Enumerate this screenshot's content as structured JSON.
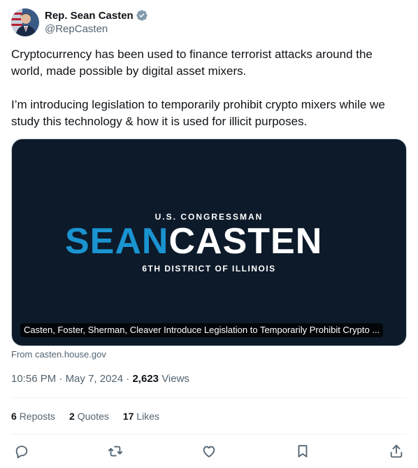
{
  "author": {
    "display_name": "Rep. Sean Casten",
    "handle": "@RepCasten",
    "verified_color": "#829aab"
  },
  "tweet": {
    "paragraphs": [
      "Cryptocurrency has been used to finance terrorist attacks around the world, made possible by digital asset mixers.",
      "I’m introducing legislation to temporarily prohibit crypto mixers while we study this technology & how it is used for illicit purposes."
    ]
  },
  "card": {
    "kicker": "U.S. CONGRESSMAN",
    "logo_part1": "SEAN",
    "logo_part2": "CASTEN",
    "subtitle": "6TH DISTRICT OF ILLINOIS",
    "caption": "Casten, Foster, Sherman, Cleaver Introduce Legislation to Temporarily Prohibit Crypto ...",
    "background_color": "#0d1a2a",
    "accent_color": "#1a93d0"
  },
  "source": "From casten.house.gov",
  "meta": {
    "time": "10:56 PM",
    "separator": "·",
    "date": "May 7, 2024",
    "views_count": "2,623",
    "views_label": "Views"
  },
  "stats": {
    "reposts_count": "6",
    "reposts_label": "Reposts",
    "quotes_count": "2",
    "quotes_label": "Quotes",
    "likes_count": "17",
    "likes_label": "Likes"
  },
  "actions": {
    "icons": [
      "reply-icon",
      "repost-icon",
      "like-icon",
      "bookmark-icon",
      "share-icon"
    ]
  },
  "colors": {
    "text_primary": "#0f1419",
    "text_secondary": "#536471",
    "icon_color": "#536471"
  }
}
